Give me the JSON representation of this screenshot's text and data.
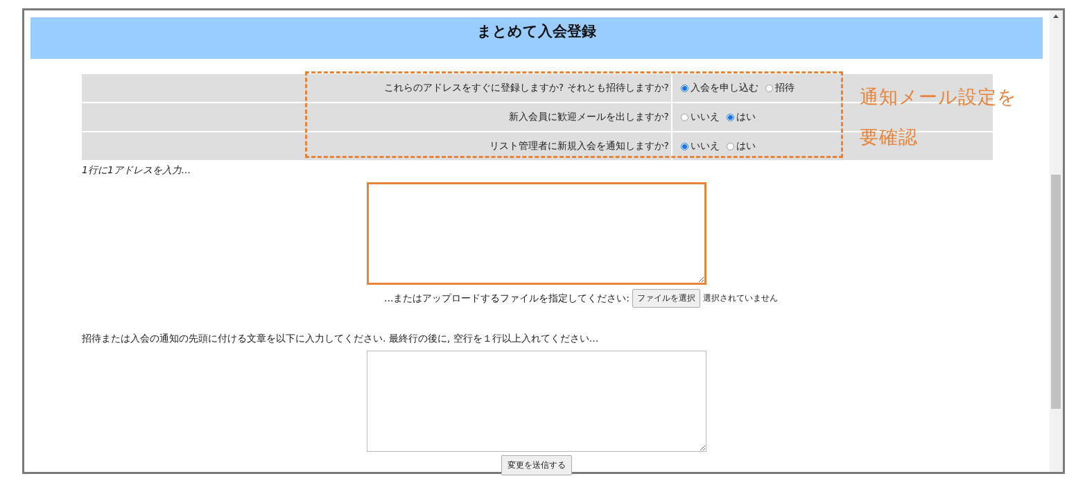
{
  "header": {
    "title": "まとめて入会登録"
  },
  "settings": [
    {
      "question": "これらのアドレスをすぐに登録しますか? それとも招待しますか?",
      "options": [
        {
          "label": "入会を申し込む",
          "selected": true
        },
        {
          "label": "招待",
          "selected": false
        }
      ]
    },
    {
      "question": "新入会員に歓迎メールを出しますか?",
      "options": [
        {
          "label": "いいえ",
          "selected": false
        },
        {
          "label": "はい",
          "selected": true
        }
      ]
    },
    {
      "question": "リスト管理者に新規入会を通知しますか?",
      "options": [
        {
          "label": "いいえ",
          "selected": true
        },
        {
          "label": "はい",
          "selected": false
        }
      ]
    }
  ],
  "settings_highlighted": true,
  "callout": "通知メール設定を要確認",
  "address_label": "1行に1アドレスを入力...",
  "address_box": {
    "highlighted": true
  },
  "upload": {
    "label": "...またはアップロードするファイルを指定してください:",
    "button": "ファイルを選択",
    "status": "選択されていません"
  },
  "message_label": "招待または入会の通知の先頭に付ける文章を以下に入力してください. 最終行の後に, 空行を１行以上入れてください...",
  "message_box": {
    "highlighted": false
  },
  "submit": "変更を送信する"
}
